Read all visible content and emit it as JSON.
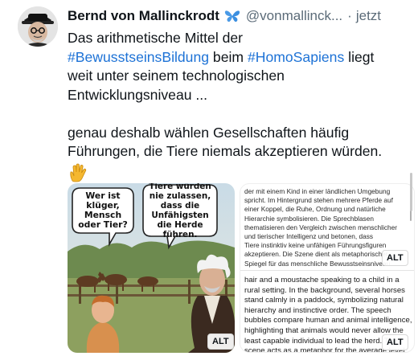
{
  "post": {
    "author_name": "Bernd von Mallinckrodt",
    "handle": "@vonmallinck...",
    "separator": "·",
    "time": "jetzt",
    "text": {
      "l1": "Das arithmetische Mittel der",
      "l2_tag1": "#BewusstseinsBildung",
      "l2_mid": " beim ",
      "l2_tag2": "#HomoSapiens",
      "l2_end": " liegt",
      "l3": "weit unter seinem technologischen",
      "l4": "Entwicklungsniveau ...",
      "l5": "genau deshalb wählen Gesellschaften häufig",
      "l6": "Führungen, die Tiere niemals akzeptieren würden."
    },
    "emoji": "🖖"
  },
  "media": {
    "image1": {
      "bubble_left": "Wer ist klüger, Mensch oder Tier?",
      "bubble_right": "Tiere würden nie zulassen, dass die Unfähigsten die Herde führen.",
      "alt_label": "ALT"
    },
    "image2": {
      "alt_label_top": "ALT",
      "alt_label_bottom": "ALT",
      "de_lines": [
        "der mit einem Kind in einer ländlichen Umgebung",
        "spricht. Im Hintergrund stehen mehrere Pferde auf",
        "einer Koppel, die Ruhe, Ordnung und natürliche",
        "Hierarchie symbolisieren. Die Sprechblasen",
        "thematisieren den Vergleich zwischen menschlicher",
        "und tierischer Intelligenz und betonen, dass",
        "Tiere instinktiv keine unfähigen Führungsfiguren",
        "akzeptieren. Die Szene dient als metaphorischer",
        "Spiegel für das menschliche Bewusstseinsniveau."
      ],
      "en_lines": [
        "hair and a moustache speaking to a child in a",
        "rural setting. In the background, several horses",
        "stand calmly in a paddock, symbolizing natural",
        "hierarchy and instinctive order. The speech",
        "bubbles compare human and animal intelligence,",
        "highlighting that animals would never allow the",
        "least capable individual to lead the herd. The",
        "scene acts as a metaphor for the average level",
        "human consciousness: while animals intuitively"
      ]
    }
  },
  "colors": {
    "hashtag": "#1d72d6",
    "verified_butterfly": "#3b8fe0"
  }
}
